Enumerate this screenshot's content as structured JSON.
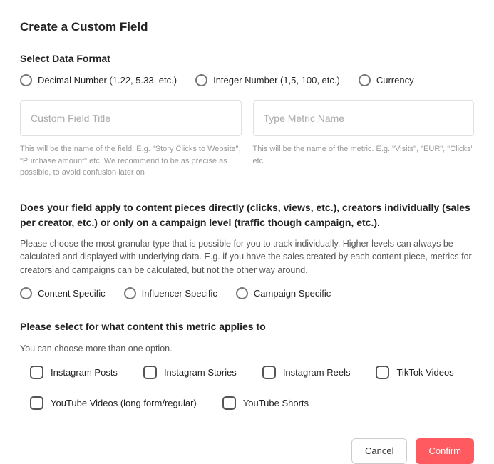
{
  "title": "Create a Custom Field",
  "dataFormat": {
    "heading": "Select Data Format",
    "options": [
      "Decimal Number (1.22, 5.33, etc.)",
      "Integer Number (1,5, 100, etc.)",
      "Currency"
    ]
  },
  "fieldTitle": {
    "placeholder": "Custom Field Title",
    "help": "This will be the name of the field. E.g. \"Story Clicks to Website\", \"Purchase amount\" etc. We recommend to be as precise as possible, to avoid confusion later on"
  },
  "metricName": {
    "placeholder": "Type Metric Name",
    "help": "This will be the name of the metric. E.g. \"Visits\", \"EUR\", \"Clicks\" etc."
  },
  "granularity": {
    "question": "Does your field apply to content pieces directly (clicks, views, etc.), creators individually (sales per creator, etc.) or only on a campaign level (traffic though campaign, etc.).",
    "help": "Please choose the most granular type that is possible for you to track individually. Higher levels can always be calculated and displayed with underlying data. E.g. if you have the sales created by each content piece, metrics for creators and campaigns can be calculated, but not the other way around.",
    "options": [
      "Content Specific",
      "Influencer Specific",
      "Campaign Specific"
    ]
  },
  "contentApplies": {
    "heading": "Please select for what content this metric applies to",
    "sub": "You can choose more than one option.",
    "options": [
      "Instagram Posts",
      "Instagram Stories",
      "Instagram Reels",
      "TikTok Videos",
      "YouTube Videos (long form/regular)",
      "YouTube Shorts"
    ]
  },
  "footer": {
    "cancel": "Cancel",
    "confirm": "Confirm"
  }
}
